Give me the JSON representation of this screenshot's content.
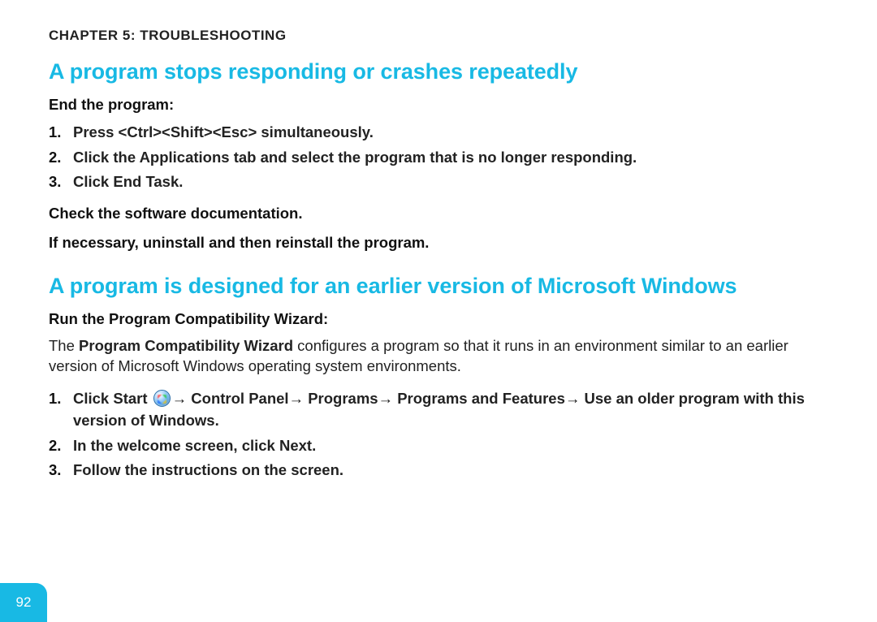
{
  "chapter": "CHAPTER 5: TROUBLESHOOTING",
  "s1": {
    "heading": "A program stops responding or crashes repeatedly",
    "sub1": "End the program:",
    "li1": "Press <Ctrl><Shift><Esc> simultaneously.",
    "li2a": "Click the ",
    "li2b": "Applications",
    "li2c": " tab and select the program that is no longer responding.",
    "li3a": "Click ",
    "li3b": "End Task",
    "li3c": ".",
    "sub2": "Check the software documentation.",
    "sub3": "If necessary, uninstall and then reinstall the program."
  },
  "s2": {
    "heading": "A program is designed for an earlier version of Microsoft Windows",
    "sub1": "Run the Program Compatibility Wizard:",
    "p1a": "The ",
    "p1b": "Program Compatibility Wizard",
    "p1c": " configures a program so that it runs in an environment similar to an earlier version of Microsoft Windows operating system environments.",
    "li1a": "Click ",
    "li1b": "Start ",
    "li1c": "→ Control Panel→ Programs→ Programs and Features→ Use an older program with this version of Windows",
    "li1d": ".",
    "li2a": "In the welcome screen, click ",
    "li2b": "Next",
    "li2c": ".",
    "li3": "Follow the instructions on the screen."
  },
  "pageNumber": "92"
}
